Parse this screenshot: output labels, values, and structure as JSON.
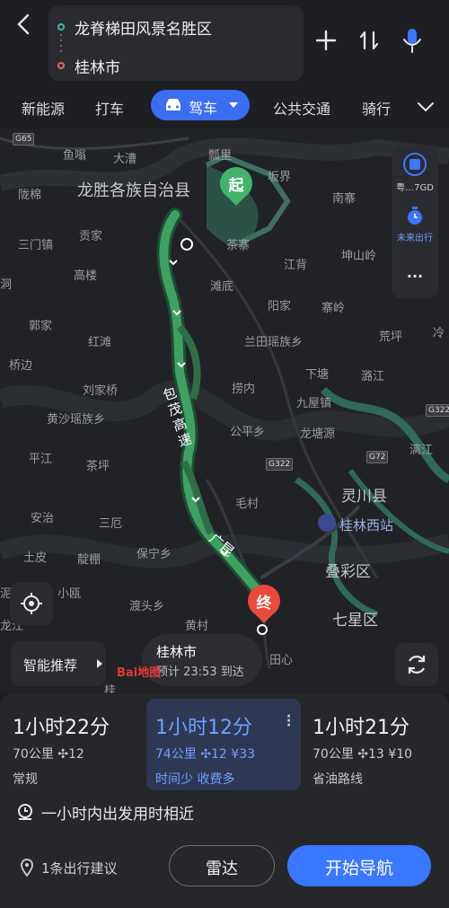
{
  "header": {
    "origin": "龙脊梯田风景名胜区",
    "destination": "桂林市"
  },
  "modes": [
    {
      "label": "新能源"
    },
    {
      "label": "打车"
    },
    {
      "label": "驾车",
      "active": true
    },
    {
      "label": "公共交通"
    },
    {
      "label": "骑行"
    }
  ],
  "map": {
    "county_label": "龙胜各族自治县",
    "lingchuan_label": "灵川县",
    "diecai_label": "叠彩区",
    "qixing_label": "七星区",
    "station_label": "桂林西站",
    "road_label": "包茂高速",
    "road_label2": "广昆",
    "start_label": "起",
    "end_label": "终",
    "places": [
      {
        "name": "鱼嗡"
      },
      {
        "name": "大漕"
      },
      {
        "name": "瓢里"
      },
      {
        "name": "坂界"
      },
      {
        "name": "陇棉"
      },
      {
        "name": "南寨"
      },
      {
        "name": "三门镇"
      },
      {
        "name": "贡家"
      },
      {
        "name": "茶寨"
      },
      {
        "name": "坤山岭"
      },
      {
        "name": "江背"
      },
      {
        "name": "高楼"
      },
      {
        "name": "滩底"
      },
      {
        "name": "阳家"
      },
      {
        "name": "寨岭"
      },
      {
        "name": "郭家"
      },
      {
        "name": "红滩"
      },
      {
        "name": "兰田瑶族乡"
      },
      {
        "name": "荒坪"
      },
      {
        "name": "桥边"
      },
      {
        "name": "下塘"
      },
      {
        "name": "潞江"
      },
      {
        "name": "刘家桥"
      },
      {
        "name": "捞内"
      },
      {
        "name": "九屋镇"
      },
      {
        "name": "黄沙瑶族乡"
      },
      {
        "name": "公平乡"
      },
      {
        "name": "龙塘源"
      },
      {
        "name": "平江"
      },
      {
        "name": "茶坪"
      },
      {
        "name": "安治"
      },
      {
        "name": "三厄"
      },
      {
        "name": "毛村"
      },
      {
        "name": "保宁乡"
      },
      {
        "name": "土皮"
      },
      {
        "name": "靛棚"
      },
      {
        "name": "小瓯"
      },
      {
        "name": "渡头乡"
      },
      {
        "name": "龙江"
      },
      {
        "name": "田心"
      },
      {
        "name": "冷"
      },
      {
        "name": "漓江"
      },
      {
        "name": "洞"
      },
      {
        "name": "泥"
      },
      {
        "name": "桂"
      },
      {
        "name": "黄村"
      }
    ],
    "shields": [
      "G65",
      "G322",
      "G322",
      "G72"
    ]
  },
  "side_panel": {
    "road_badge": "粤…7GD",
    "future_label": "未来出行",
    "more_label": "···"
  },
  "smart_label": "智能推荐",
  "bubble": {
    "city": "桂林市",
    "eta": "预计 23:53 到达"
  },
  "baidu_logo": "Bai地图",
  "routes": [
    {
      "time": "1小时22分",
      "distance": "70公里",
      "lights": "12",
      "toll": "",
      "tag": "常规"
    },
    {
      "time": "1小时12分",
      "distance": "74公里",
      "lights": "12",
      "toll": "¥33",
      "tag": "时间少 收费多"
    },
    {
      "time": "1小时21分",
      "distance": "70公里",
      "lights": "13",
      "toll": "¥10",
      "tag": "省油路线"
    }
  ],
  "tip": "一小时内出发用时相近",
  "suggest": "1条出行建议",
  "radar_label": "雷达",
  "nav_label": "开始导航",
  "colors": {
    "accent": "#3a78ff",
    "route": "#3fa15f",
    "start": "#43b36b",
    "end": "#e84a3c"
  }
}
